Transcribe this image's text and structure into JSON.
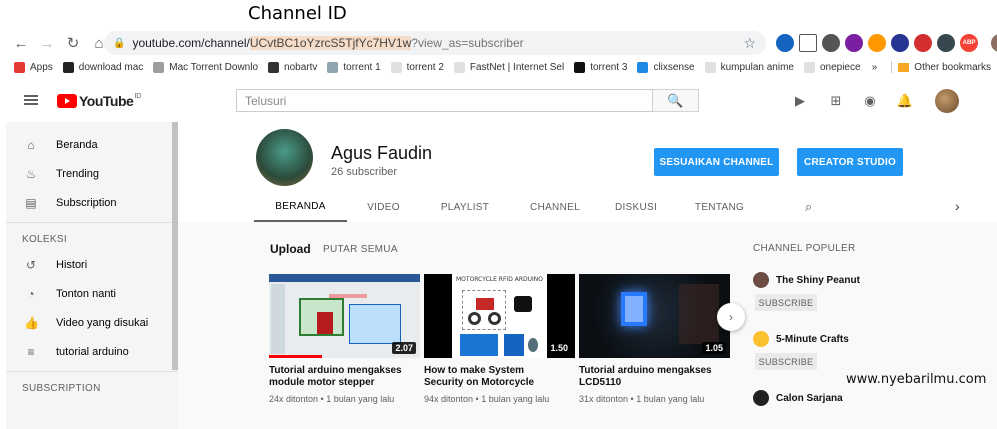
{
  "annotation": {
    "title": "Channel ID",
    "watermark": "www.nyebarilmu.com"
  },
  "browser": {
    "url_prefix": "youtube.com/channel/",
    "url_channel_id": "UCvtBC1oYzrcS5TjfYc7HV1w",
    "url_suffix": "?view_as=subscriber",
    "bookmarks": [
      {
        "label": "Apps",
        "color": "#e53935"
      },
      {
        "label": "download mac",
        "color": "#222222"
      },
      {
        "label": "Mac Torrent Downlo",
        "color": "#9e9e9e"
      },
      {
        "label": "nobartv",
        "color": "#333333"
      },
      {
        "label": "torrent 1",
        "color": "#90a4ae"
      },
      {
        "label": "torrent 2",
        "color": "#e0e0e0"
      },
      {
        "label": "FastNet | Internet Sel",
        "color": "#e0e0e0"
      },
      {
        "label": "torrent 3",
        "color": "#111111"
      },
      {
        "label": "clixsense",
        "color": "#1e88e5"
      },
      {
        "label": "kumpulan anime",
        "color": "#e0e0e0"
      },
      {
        "label": "onepiece",
        "color": "#e0e0e0"
      }
    ],
    "bookmarks_more": "»",
    "other_bookmarks": "Other bookmarks"
  },
  "masthead": {
    "logo_text": "YouTube",
    "logo_region": "ID",
    "search_placeholder": "Telusuri"
  },
  "sidebar": {
    "main": [
      {
        "label": "Beranda",
        "icon": "home-icon",
        "glyph": "⌂"
      },
      {
        "label": "Trending",
        "icon": "flame-icon",
        "glyph": "♨"
      },
      {
        "label": "Subscription",
        "icon": "subscriptions-icon",
        "glyph": "▤"
      }
    ],
    "koleksi_heading": "KOLEKSI",
    "koleksi": [
      {
        "label": "Histori",
        "icon": "history-icon",
        "glyph": "↺"
      },
      {
        "label": "Tonton nanti",
        "icon": "clock-icon",
        "glyph": "◔"
      },
      {
        "label": "Video yang disukai",
        "icon": "thumb-up-icon",
        "glyph": "👍"
      },
      {
        "label": "tutorial arduino",
        "icon": "playlist-icon",
        "glyph": "≡"
      }
    ],
    "subscription_heading": "SUBSCRIPTION"
  },
  "channel": {
    "name": "Agus Faudin",
    "subscribers": "26 subscriber",
    "btn_customize": "SESUAIKAN CHANNEL",
    "btn_studio": "CREATOR STUDIO",
    "accent_color": "#2196f3",
    "tabs": [
      "BERANDA",
      "VIDEO",
      "PLAYLIST",
      "CHANNEL",
      "DISKUSI",
      "TENTANG"
    ],
    "active_tab": "BERANDA"
  },
  "uploads": {
    "heading": "Upload",
    "play_all": "PUTAR SEMUA",
    "videos": [
      {
        "title": "Tutorial arduino mengakses module motor stepper",
        "meta": "24x ditonton • 1 bulan yang lalu",
        "duration": "2.07",
        "watched": 0.35
      },
      {
        "title": "How to make System Security on Motorcycle usin...",
        "meta": "94x ditonton • 1 bulan yang lalu",
        "duration": "1.50",
        "watched": 0.0,
        "thumb_caption": "MOTORCYCLE RFID ARDUINO"
      },
      {
        "title": "Tutorial arduino mengakses LCD5110",
        "meta": "31x ditonton • 1 bulan yang lalu",
        "duration": "1.05",
        "watched": 0.0
      }
    ]
  },
  "popular": {
    "heading": "CHANNEL POPULER",
    "subscribe_label": "SUBSCRIBE",
    "channels": [
      {
        "name": "The Shiny Peanut",
        "color": "#6d4c41"
      },
      {
        "name": "5-Minute Crafts",
        "color": "#fbc02d"
      },
      {
        "name": "Calon Sarjana",
        "color": "#212121"
      }
    ]
  }
}
